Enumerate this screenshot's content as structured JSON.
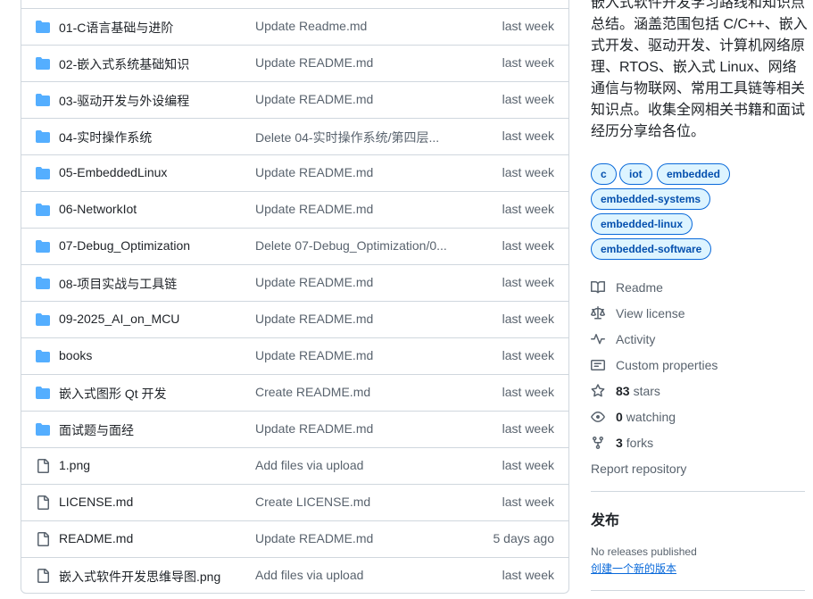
{
  "files": [
    {
      "type": "folder",
      "name": "01-C语言基础与进阶",
      "commit": "Update Readme.md",
      "age": "last week"
    },
    {
      "type": "folder",
      "name": "02-嵌入式系统基础知识",
      "commit": "Update README.md",
      "age": "last week"
    },
    {
      "type": "folder",
      "name": "03-驱动开发与外设编程",
      "commit": "Update README.md",
      "age": "last week"
    },
    {
      "type": "folder",
      "name": "04-实时操作系统",
      "commit": "Delete 04-实时操作系统/第四层...",
      "age": "last week"
    },
    {
      "type": "folder",
      "name": "05-EmbeddedLinux",
      "commit": "Update README.md",
      "age": "last week"
    },
    {
      "type": "folder",
      "name": "06-NetworkIot",
      "commit": "Update README.md",
      "age": "last week"
    },
    {
      "type": "folder",
      "name": "07-Debug_Optimization",
      "commit": "Delete 07-Debug_Optimization/0...",
      "age": "last week"
    },
    {
      "type": "folder",
      "name": "08-项目实战与工具链",
      "commit": "Update README.md",
      "age": "last week"
    },
    {
      "type": "folder",
      "name": "09-2025_AI_on_MCU",
      "commit": "Update README.md",
      "age": "last week"
    },
    {
      "type": "folder",
      "name": "books",
      "commit": "Update README.md",
      "age": "last week"
    },
    {
      "type": "folder",
      "name": "嵌入式图形 Qt 开发",
      "commit": "Create README.md",
      "age": "last week"
    },
    {
      "type": "folder",
      "name": "面试题与面经",
      "commit": "Update README.md",
      "age": "last week"
    },
    {
      "type": "file",
      "name": "1.png",
      "commit": "Add files via upload",
      "age": "last week"
    },
    {
      "type": "file",
      "name": "LICENSE.md",
      "commit": "Create LICENSE.md",
      "age": "last week"
    },
    {
      "type": "file",
      "name": "README.md",
      "commit": "Update README.md",
      "age": "5 days ago"
    },
    {
      "type": "file",
      "name": "嵌入式软件开发思维导图.png",
      "commit": "Add files via upload",
      "age": "last week"
    }
  ],
  "about": {
    "description": "嵌入式软件开发学习路线和知识点总结。涵盖范围包括 C/C++、嵌入式开发、驱动开发、计算机网络原理、RTOS、嵌入式 Linux、网络通信与物联网、常用工具链等相关知识点。收集全网相关书籍和面试经历分享给各位。"
  },
  "topics": [
    "c",
    "iot",
    "embedded",
    "embedded-systems",
    "embedded-linux",
    "embedded-software"
  ],
  "meta": {
    "readme": "Readme",
    "license": "View license",
    "activity": "Activity",
    "custom_properties": "Custom properties",
    "stars_count": "83",
    "stars_label": "stars",
    "watching_count": "0",
    "watching_label": "watching",
    "forks_count": "3",
    "forks_label": "forks",
    "report": "Report repository"
  },
  "releases": {
    "title": "发布",
    "none": "No releases published",
    "create_link": "创建一个新的版本"
  },
  "colors": {
    "folder": "#54aeff",
    "link": "#0969da",
    "muted": "#59636e",
    "border": "#d0d7de",
    "topic_bg": "#ddf4ff"
  }
}
